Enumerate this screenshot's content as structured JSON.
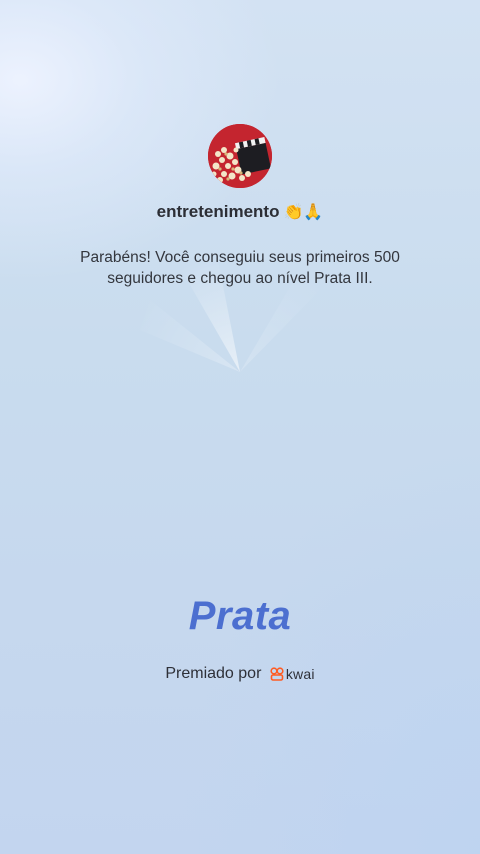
{
  "profile": {
    "username": "entretenimento",
    "emojis": "👏🙏",
    "avatar_icon": "popcorn-clapperboard-icon"
  },
  "message": "Parabéns! Você conseguiu seus primeiros 500 seguidores e chegou ao nível Prata III.",
  "level": {
    "title": "Prata"
  },
  "award": {
    "prefix": "Premiado por",
    "brand": "kwai",
    "brand_icon": "kwai-logo-icon"
  },
  "colors": {
    "level_title": "#4c6fd0",
    "brand_accent": "#ff5c22",
    "avatar_bg": "#c4252f"
  }
}
